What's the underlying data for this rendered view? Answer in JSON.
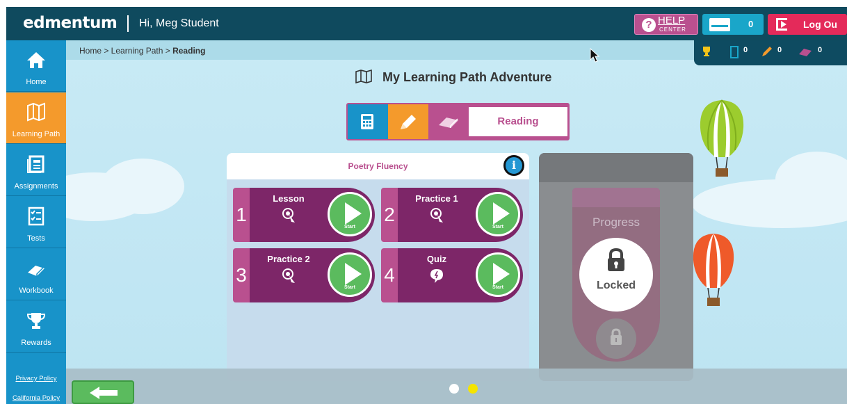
{
  "header": {
    "logo": "edmentum",
    "greeting": "Hi, Meg Student",
    "help": {
      "label": "HELP",
      "sub": "CENTER"
    },
    "messages_count": "0",
    "logout_label": "Log Ou"
  },
  "sidebar": {
    "items": [
      {
        "label": "Home",
        "icon": "home-icon"
      },
      {
        "label": "Learning Path",
        "icon": "map-icon"
      },
      {
        "label": "Assignments",
        "icon": "assignments-icon"
      },
      {
        "label": "Tests",
        "icon": "checklist-icon"
      },
      {
        "label": "Workbook",
        "icon": "book-icon"
      },
      {
        "label": "Rewards",
        "icon": "trophy-icon"
      }
    ],
    "privacy_policy": "Privacy Policy",
    "california_policy": "California Policy"
  },
  "breadcrumb": {
    "prefix": "Home > Learning Path > ",
    "current": "Reading"
  },
  "stats": {
    "trophies": "",
    "items": [
      {
        "icon": "calculator-icon",
        "value": "0"
      },
      {
        "icon": "pencil-icon",
        "value": "0"
      },
      {
        "icon": "book-icon",
        "value": "0"
      }
    ]
  },
  "main": {
    "title": "My Learning Path Adventure",
    "subjects": [
      {
        "icon": "calculator-icon",
        "color": "#1893c9"
      },
      {
        "icon": "pencil-icon",
        "color": "#f49a2c"
      },
      {
        "icon": "book-icon",
        "color": "#b9508f"
      }
    ],
    "selected_subject": "Reading",
    "module_title": "Poetry Fluency",
    "activities": [
      {
        "num": "1",
        "label": "Lesson",
        "start": "Start"
      },
      {
        "num": "2",
        "label": "Practice 1",
        "start": "Start"
      },
      {
        "num": "3",
        "label": "Practice 2",
        "start": "Start"
      },
      {
        "num": "4",
        "label": "Quiz",
        "start": "Start"
      }
    ]
  },
  "progress": {
    "label": "Progress",
    "status": "Locked"
  },
  "colors": {
    "purple": "#7d2668",
    "pink": "#b9508f",
    "green": "#5bbb5e",
    "teal": "#0f4a5e",
    "blue": "#1893c9",
    "orange": "#f49a2c"
  }
}
